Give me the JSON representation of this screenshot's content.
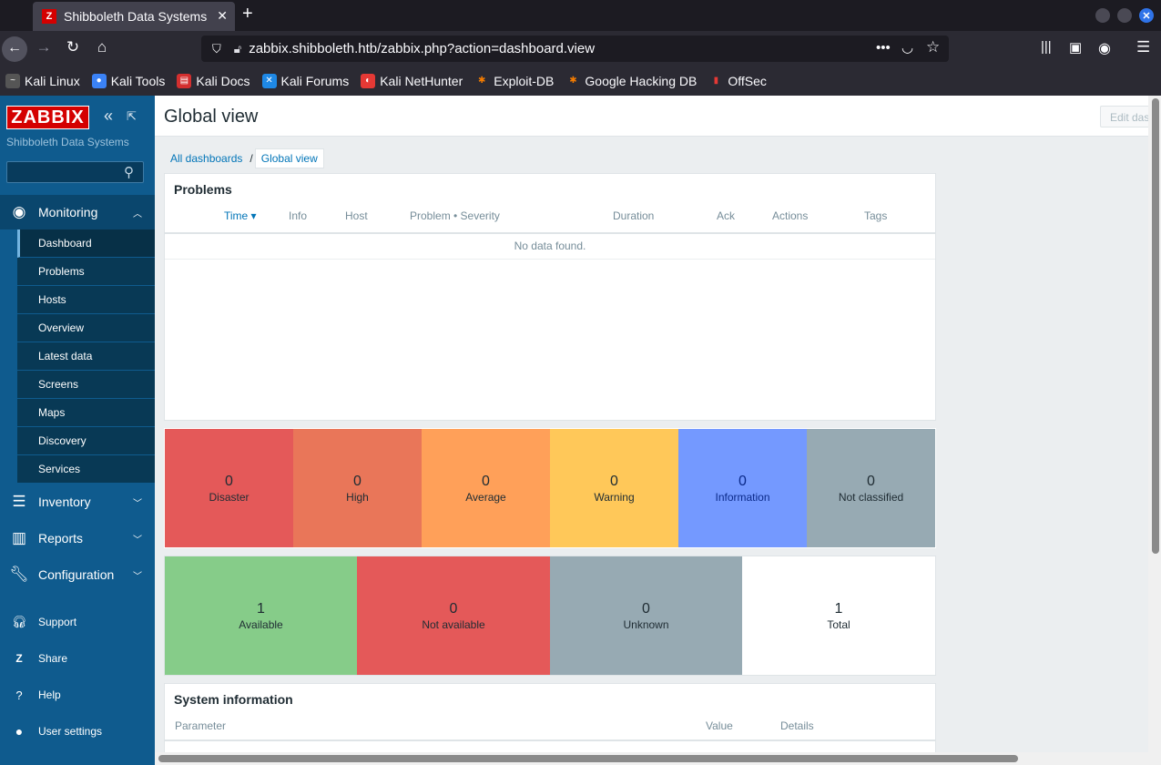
{
  "browser": {
    "tab_title": "Shibboleth Data Systems",
    "tab_favicon": "Z",
    "url": "zabbix.shibboleth.htb/zabbix.php?action=dashboard.view",
    "bookmarks": [
      {
        "label": "Kali Linux",
        "icon": "kali-dragon-icon",
        "color": "#2b2a33"
      },
      {
        "label": "Kali Tools",
        "icon": "kali-tools-icon",
        "color": "#3b82f6"
      },
      {
        "label": "Kali Docs",
        "icon": "kali-docs-icon",
        "color": "#d32f2f"
      },
      {
        "label": "Kali Forums",
        "icon": "kali-forums-icon",
        "color": "#1e88e5"
      },
      {
        "label": "Kali NetHunter",
        "icon": "kali-nethunter-icon",
        "color": "#e53935"
      },
      {
        "label": "Exploit-DB",
        "icon": "exploit-db-icon",
        "color": "#f57c00"
      },
      {
        "label": "Google Hacking DB",
        "icon": "ghdb-icon",
        "color": "#f57c00"
      },
      {
        "label": "OffSec",
        "icon": "offsec-icon",
        "color": "#c62828"
      }
    ]
  },
  "sidebar": {
    "logo": "ZABBIX",
    "org_name": "Shibboleth Data Systems",
    "search_placeholder": "",
    "monitoring": {
      "label": "Monitoring"
    },
    "monitoring_items": [
      {
        "label": "Dashboard",
        "active": true
      },
      {
        "label": "Problems"
      },
      {
        "label": "Hosts"
      },
      {
        "label": "Overview"
      },
      {
        "label": "Latest data"
      },
      {
        "label": "Screens"
      },
      {
        "label": "Maps"
      },
      {
        "label": "Discovery"
      },
      {
        "label": "Services"
      }
    ],
    "inventory": "Inventory",
    "reports": "Reports",
    "configuration": "Configuration",
    "support": "Support",
    "share": "Share",
    "help": "Help",
    "user_settings": "User settings"
  },
  "main": {
    "title": "Global view",
    "edit_button": "Edit dashboard",
    "breadcrumb": {
      "all": "All dashboards",
      "separator": "/",
      "current": "Global view"
    },
    "problems": {
      "title": "Problems",
      "columns": [
        "Time ▾",
        "Info",
        "Host",
        "Problem • Severity",
        "Duration",
        "Ack",
        "Actions",
        "Tags"
      ],
      "empty": "No data found."
    },
    "severities": [
      {
        "count": "0",
        "label": "Disaster",
        "color": "#e45959"
      },
      {
        "count": "0",
        "label": "High",
        "color": "#e97659"
      },
      {
        "count": "0",
        "label": "Average",
        "color": "#ffa059"
      },
      {
        "count": "0",
        "label": "Warning",
        "color": "#ffc859"
      },
      {
        "count": "0",
        "label": "Information",
        "color": "#7499ff"
      },
      {
        "count": "0",
        "label": "Not classified",
        "color": "#97aab3"
      }
    ],
    "hosts": [
      {
        "count": "1",
        "label": "Available",
        "color": "#86cc89"
      },
      {
        "count": "0",
        "label": "Not available",
        "color": "#e45959"
      },
      {
        "count": "0",
        "label": "Unknown",
        "color": "#97aab3"
      },
      {
        "count": "1",
        "label": "Total",
        "color": "#ffffff"
      }
    ],
    "system_info": {
      "title": "System information",
      "columns": [
        "Parameter",
        "Value",
        "Details"
      ]
    }
  }
}
